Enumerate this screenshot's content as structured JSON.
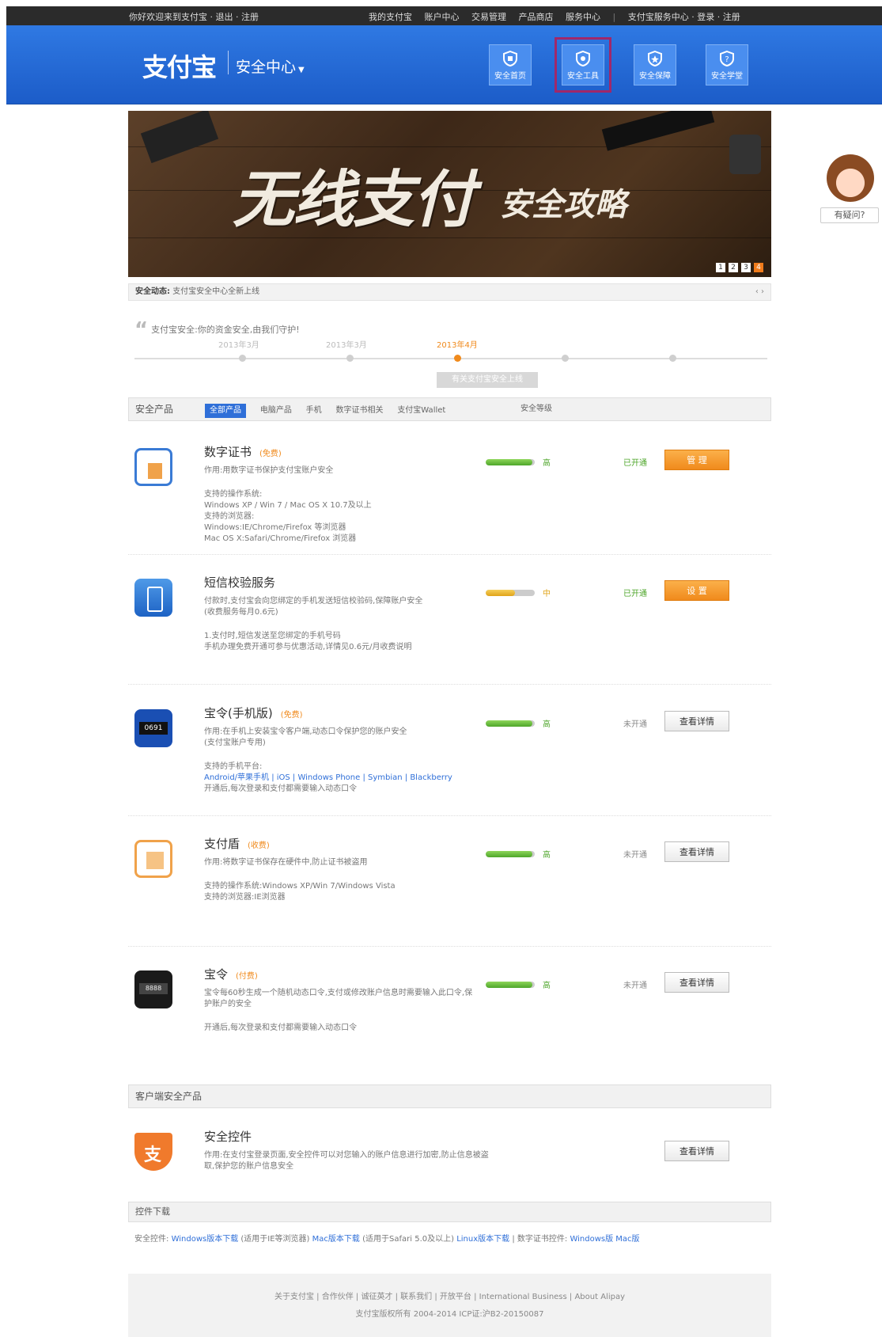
{
  "topbar": {
    "left": "你好欢迎来到支付宝 · 退出 · 注册",
    "links": [
      "我的支付宝",
      "账户中心",
      "交易管理",
      "产品商店",
      "服务中心"
    ],
    "right": "支付宝服务中心 · 登录 · 注册"
  },
  "header": {
    "logo": "支付宝",
    "subtitle": "安全中心",
    "nav": [
      {
        "label": "安全首页",
        "icon": "shield-home-icon"
      },
      {
        "label": "安全工具",
        "icon": "tools-icon"
      },
      {
        "label": "安全保障",
        "icon": "shield-star-icon"
      },
      {
        "label": "安全学堂",
        "icon": "question-icon"
      }
    ]
  },
  "banner": {
    "title_big": "无线支付",
    "title_small": "安全攻略",
    "pages": [
      "1",
      "2",
      "3",
      "4"
    ]
  },
  "side": {
    "label": "有疑问?"
  },
  "news": {
    "label": "安全动态:",
    "text": "支付宝安全中心全新上线"
  },
  "timeline": {
    "quote": "支付宝安全:你的资金安全,由我们守护!",
    "dates": [
      "2013年3月",
      "2013年3月",
      "2013年4月"
    ],
    "tip": "有关支付宝安全上线"
  },
  "products_section": {
    "title": "安全产品",
    "tabs": [
      "全部产品",
      "电脑产品",
      "手机",
      "数字证书相关",
      "支付宝Wallet"
    ],
    "col_header": "安全等级"
  },
  "products": [
    {
      "name": "数字证书",
      "tag": "(免费)",
      "desc": [
        "作用:用数字证书保护支付宝账户安全",
        "",
        "支持的操作系统:",
        "Windows XP / Win 7 / Mac OS X 10.7及以上",
        "支持的浏览器:",
        "Windows:IE/Chrome/Firefox 等浏览器",
        "Mac OS X:Safari/Chrome/Firefox 浏览器"
      ],
      "bar": 0.95,
      "bar_label": "高",
      "status": "已开通",
      "button": "管 理"
    },
    {
      "name": "短信校验服务",
      "tag": "",
      "desc": [
        "付款时,支付宝会向您绑定的手机发送短信校验码,保障账户安全",
        "(收费服务每月0.6元)",
        "",
        "1.支付时,短信发送至您绑定的手机号码",
        "手机办理免费开通可参与优惠活动,详情见0.6元/月收费说明"
      ],
      "bar": 0.6,
      "bar_label": "中",
      "status": "已开通",
      "button": "设 置"
    },
    {
      "name": "宝令(手机版)",
      "tag": "(免费)",
      "desc": [
        "作用:在手机上安装宝令客户端,动态口令保护您的账户安全",
        "(支付宝账户专用)",
        "",
        "支持的手机平台:",
        "Android/苹果手机 | iOS | Windows Phone | Symbian | Blackberry",
        "开通后,每次登录和支付都需要输入动态口令"
      ],
      "bar": 0.95,
      "bar_label": "高",
      "status": "未开通",
      "button": "查看详情"
    },
    {
      "name": "支付盾",
      "tag": "(收费)",
      "desc": [
        "作用:将数字证书保存在硬件中,防止证书被盗用",
        "",
        "支持的操作系统:Windows XP/Win 7/Windows Vista",
        "支持的浏览器:IE浏览器"
      ],
      "bar": 0.95,
      "bar_label": "高",
      "status": "未开通",
      "button": "查看详情"
    },
    {
      "name": "宝令",
      "tag": "(付费)",
      "desc": [
        "宝令每60秒生成一个随机动态口令,支付或修改账户信息时需要输入此口令,保",
        "护账户的安全",
        "",
        "开通后,每次登录和支付都需要输入动态口令"
      ],
      "bar": 0.95,
      "bar_label": "高",
      "status": "未开通",
      "button": "查看详情"
    }
  ],
  "control_section": {
    "title": "客户端安全产品",
    "name": "安全控件",
    "desc": [
      "作用:在支付宝登录页面,安全控件可以对您输入的账户信息进行加密,防止信息被盗",
      "取,保护您的账户信息安全"
    ],
    "button": "查看详情"
  },
  "downloads": {
    "title": "控件下载",
    "label1": "安全控件:",
    "link1": "Windows版本下载",
    "note1": "(适用于IE等浏览器)",
    "link2": "Mac版本下载",
    "note2": "(适用于Safari 5.0及以上)",
    "link3": "Linux版本下载",
    "label2": "数字证书控件:",
    "link4": "Windows版 Mac版"
  },
  "footer": {
    "line1": "关于支付宝 | 合作伙伴 | 诚征英才 | 联系我们 | 开放平台 | International Business | About Alipay",
    "line2": "支付宝版权所有 2004-2014 ICP证:沪B2-20150087"
  }
}
